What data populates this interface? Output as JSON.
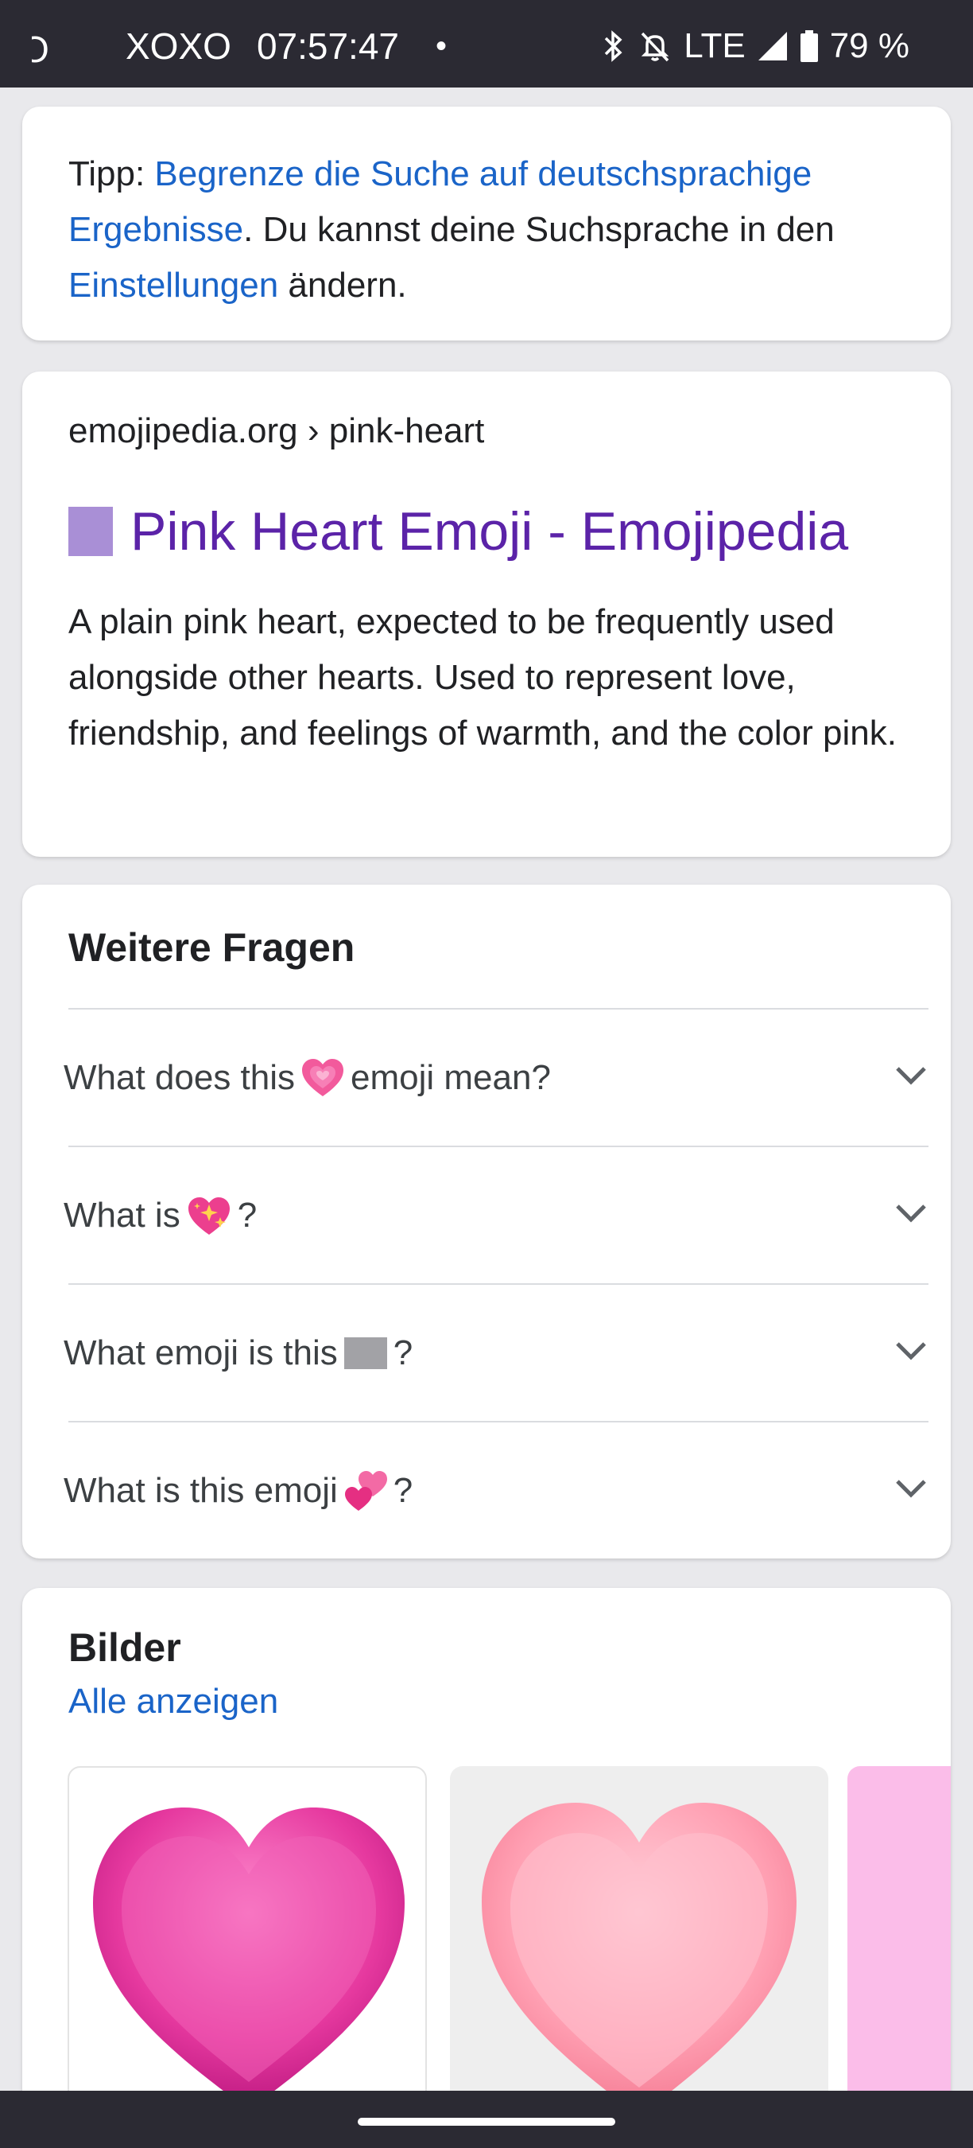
{
  "status_bar": {
    "partial_left": "O",
    "carrier": "XOXO",
    "time": "07:57:47",
    "dot": "•",
    "network": "LTE",
    "battery": "79 %"
  },
  "tip": {
    "prefix": "Tipp: ",
    "link1": "Begrenze die Suche auf deutschsprachige Ergebnisse",
    "middle": ". Du kannst deine Suchsprache in den ",
    "link2": "Einstellungen",
    "suffix": " ändern."
  },
  "result": {
    "breadcrumb": "emojipedia.org › pink-heart",
    "title": "Pink Heart Emoji - Emojipedia",
    "description": "A plain pink heart, expected to be frequently used alongside other hearts. Used to represent love, friendship, and feelings of warmth, and the color pink."
  },
  "questions": {
    "title": "Weitere Fragen",
    "items": [
      {
        "before": "What does this ",
        "emoji": "growing-heart-icon",
        "after": " emoji mean?"
      },
      {
        "before": "What is ",
        "emoji": "sparkling-heart-icon",
        "after": "?"
      },
      {
        "before": "What emoji is this ",
        "emoji": "unknown-glyph-box",
        "after": "?"
      },
      {
        "before": "What is this emoji ",
        "emoji": "two-hearts-icon",
        "after": "?"
      }
    ]
  },
  "images": {
    "title": "Bilder",
    "see_all": "Alle anzeigen"
  },
  "colors": {
    "link": "#1a64c8",
    "visited_title": "#5b23a8",
    "status_bar": "#2b2a33"
  }
}
